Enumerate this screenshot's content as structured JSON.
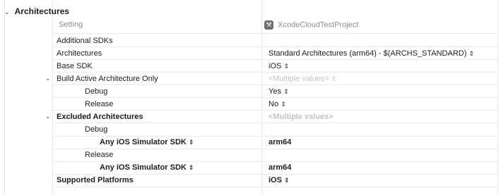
{
  "section": {
    "title": "Architectures"
  },
  "header": {
    "setting": "Setting",
    "project": "XcodeCloudTestProject"
  },
  "rows": {
    "additional_sdks": {
      "label": "Additional SDKs",
      "value": ""
    },
    "architectures": {
      "label": "Architectures",
      "value": "Standard Architectures (arm64)  -  $(ARCHS_STANDARD)"
    },
    "base_sdk": {
      "label": "Base SDK",
      "value": "iOS"
    },
    "build_active": {
      "label": "Build Active Architecture Only",
      "value": "<Multiple values>"
    },
    "build_active_debug": {
      "label": "Debug",
      "value": "Yes"
    },
    "build_active_release": {
      "label": "Release",
      "value": "No"
    },
    "excluded": {
      "label": "Excluded Architectures",
      "value": "<Multiple values>"
    },
    "excluded_debug": {
      "label": "Debug"
    },
    "excluded_debug_sim": {
      "label": "Any iOS Simulator SDK",
      "value": "arm64"
    },
    "excluded_release": {
      "label": "Release"
    },
    "excluded_release_sim": {
      "label": "Any iOS Simulator SDK",
      "value": "arm64"
    },
    "supported_platforms": {
      "label": "Supported Platforms",
      "value": "iOS"
    }
  },
  "icons": {
    "updown": "⇕",
    "chevron_down": "⌄",
    "project": "hammer"
  }
}
